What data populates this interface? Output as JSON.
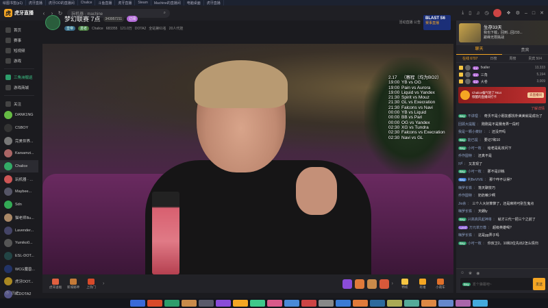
{
  "taskbar": [
    "绘图书签(p1)",
    "虎牙直播",
    "虎牙OO的直播间",
    "Chalice",
    "斗鱼直播",
    "虎牙直播",
    "Steam",
    "Machine的直播间",
    "电脑桌面",
    "虎牙直播"
  ],
  "app": {
    "name": "虎牙直播",
    "search_text": "玩机器 · machine",
    "back_icon": "‹",
    "forward_icon": "›",
    "refresh_icon": "↻"
  },
  "sidebar": {
    "main": [
      {
        "label": "首页",
        "icon": "home-icon"
      },
      {
        "label": "赛事",
        "icon": "trophy-icon"
      },
      {
        "label": "短视频",
        "icon": "video-icon"
      },
      {
        "label": "游戏",
        "icon": "gamepad-icon"
      },
      {
        "label": "三角洲舰巡",
        "icon": "delta-icon",
        "green": true
      },
      {
        "label": "游戏商城",
        "icon": "store-icon"
      }
    ],
    "follow_label": "关注",
    "follows": [
      "DANK1NG",
      "CSBOY",
      "完美世界...",
      "Karsamzi...",
      "Chalice",
      "玩机器 · ...",
      "Maybee...",
      "Sdn",
      "猫老师Bu...",
      "Lavender...",
      "Yumiko0...",
      "ESL-DOT...",
      "WCG魔兽...",
      "虎牙DOT...",
      "ICDOTA2"
    ],
    "follow_colors": [
      "#6b4",
      "#333",
      "#777",
      "#a66",
      "#3a6",
      "#c55",
      "#556",
      "#3a5",
      "#a86",
      "#446",
      "#555",
      "#244",
      "#236",
      "#a82",
      "#558"
    ],
    "history_label": "历史"
  },
  "header": {
    "title": "梦幻联赛 7点",
    "room_chip": "343957211",
    "sub_chip": "订阅",
    "streamer": "Chalice",
    "viewers": "683355",
    "likes": "121.0万",
    "game": "DOTA2",
    "followers": "全站第61名",
    "fans": "20人代挂",
    "badge1": "皇帝",
    "badge2": "勇者",
    "banner_small": "活动直播\n公告",
    "banner_title": "BLAST S6",
    "banner_sub": "赛事直播"
  },
  "schedule": [
    {
      "time": "2.17",
      "match": "（赛程（均为BO2）"
    },
    {
      "time": "19:00",
      "match": "YB vs OG"
    },
    {
      "time": "19:00",
      "match": "Pain vs Aurora"
    },
    {
      "time": "19:00",
      "match": "Liquid vs Yandex"
    },
    {
      "time": "21:30",
      "match": "Spirit vs Mouz"
    },
    {
      "time": "21:30",
      "match": "GL vs Execration"
    },
    {
      "time": "21:30",
      "match": "Falcons vs Navi"
    },
    {
      "time": "00:00",
      "match": "YB vs Liquid"
    },
    {
      "time": "00:00",
      "match": "BB vs Pari"
    },
    {
      "time": "00:00",
      "match": "OG vs Yandex"
    },
    {
      "time": "02:30",
      "match": "XG vs Tundra"
    },
    {
      "time": "02:30",
      "match": "Falcons vs Execration"
    },
    {
      "time": "02:30",
      "match": "Navi vs GL"
    }
  ],
  "controls": {
    "left": [
      {
        "label": "虎牙送福",
        "color": "#e06040"
      },
      {
        "label": "新城秘神",
        "color": "#c47a38"
      },
      {
        "label": "上热门",
        "color": "#d84a2a"
      }
    ],
    "right": [
      {
        "label": "特权",
        "color": "#f5c542"
      },
      {
        "label": "有谁",
        "color": "#f5a623"
      },
      {
        "label": "小夜车",
        "color": "#e0702a"
      }
    ]
  },
  "rpanel": {
    "ad_title": "生存33天",
    "ad_sub": "我也下载，回到...回233...",
    "ad_label": "巅峰无限挑战",
    "tabs": [
      "聊天",
      "贵宾"
    ],
    "subtabs": [
      "在线 6707",
      "日榜",
      "周榜",
      "贵宾 504"
    ],
    "ranks": [
      {
        "name": "fxaller",
        "score": "13,333"
      },
      {
        "name": "三角",
        "score": "5,194"
      },
      {
        "name": "大卷",
        "score": "3,009"
      }
    ],
    "promo_title": "Chalice偏气轻了7814",
    "promo_sub": "惊醒的直播间打卡",
    "promo_btn": "去直播间",
    "notice_1": "了解详情",
    "messages": [
      {
        "badge": "Bay",
        "bcolor": "g",
        "name": "不讲理",
        "text": "奇沃不是小朋友都找朴美美就是成功了"
      },
      {
        "badge": "",
        "name": "回顾大提醒",
        "text": "刚刚是不是赛肯弄一段时"
      },
      {
        "badge": "",
        "name": "我是一颗小菜好",
        "text": "：还没开吗"
      },
      {
        "badge": "Bay",
        "bcolor": "g",
        "name": "能已提",
        "text": "要记7和10"
      },
      {
        "badge": "Bay",
        "bcolor": "g",
        "name": "小可一枚",
        "text": "给老是乱攻问下"
      },
      {
        "badge": "",
        "name": "乔作圆特",
        "text": "还真不是"
      },
      {
        "badge": "",
        "name": "yyl",
        "text": "又发现了"
      },
      {
        "badge": "Bay",
        "bcolor": "g",
        "name": "小可一枚",
        "text": "那不是训练"
      },
      {
        "badge": "Bay",
        "bcolor": "bl",
        "name": "利BeVIVE",
        "text": "那个咋不认得?"
      },
      {
        "badge": "",
        "name": "嗨罗长铁",
        "text": "落天聊技巧"
      },
      {
        "badge": "",
        "name": "乔作圆特",
        "text": "奶奶嘛少啊"
      },
      {
        "badge": "",
        "name": "Jio余",
        "text": "三个人大好算算了，还是麻将可别生鬼点"
      },
      {
        "badge": "",
        "name": "嗨罗长铁",
        "text": "天朗ly"
      },
      {
        "badge": "Bay",
        "bcolor": "g",
        "name": "兴高高风起神将",
        "text": "就才三代一把三个之前了"
      },
      {
        "badge": "Lpod",
        "bcolor": "pu",
        "name": "万元单万尊",
        "text": "超级英雄喝?"
      },
      {
        "badge": "",
        "name": "嗨罗长铁",
        "text": "这是gg弄子吗"
      },
      {
        "badge": "Bay",
        "bcolor": "g",
        "name": "小可一枚",
        "text": "你双卫2。10和3位先出2怎么情归"
      }
    ],
    "input_badge": "Bay",
    "input_placeholder": "发个弹幕吧~",
    "send_label": "发送"
  }
}
